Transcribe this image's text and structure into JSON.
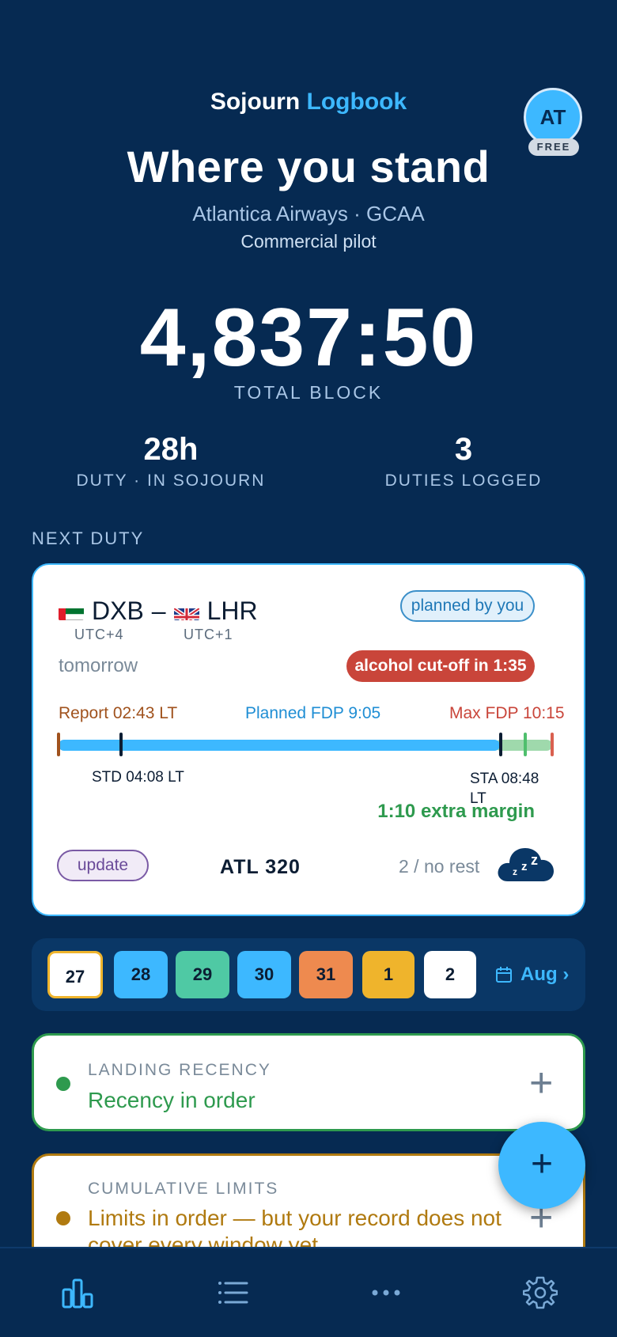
{
  "header": {
    "brand_part1": "Sojourn",
    "brand_part2": "Logbook",
    "title": "Where you stand",
    "airline_authority": "Atlantica Airways · GCAA",
    "role": "Commercial pilot",
    "avatar_initials": "AT",
    "plan_badge": "FREE"
  },
  "totals": {
    "total_block": "4,837:50",
    "total_block_label": "TOTAL BLOCK",
    "duty_value": "28h",
    "duty_label": "DUTY · IN SOJOURN",
    "duties_value": "3",
    "duties_label": "DUTIES LOGGED"
  },
  "next_duty": {
    "section_label": "NEXT DUTY",
    "origin": "DXB",
    "dash": "–",
    "destination": "LHR",
    "origin_utc": "UTC+4",
    "destination_utc": "UTC+1",
    "planned_badge": "planned by you",
    "when": "tomorrow",
    "alcohol_badge": "alcohol cut-off in 1:35",
    "report": "Report 02:43 LT",
    "planned_fdp": "Planned FDP 9:05",
    "max_fdp": "Max FDP 10:15",
    "std": "STD 04:08 LT",
    "sta": "STA 08:48 LT",
    "extra_margin": "1:10 extra margin",
    "update_button": "update",
    "aircraft": "ATL 320",
    "rest": "2 / no rest",
    "sleep_icon": "sleep-cloud-icon"
  },
  "date_strip": {
    "days": [
      {
        "label": "27",
        "color": "#ffffff",
        "selected": true
      },
      {
        "label": "28",
        "color": "#3db8ff"
      },
      {
        "label": "29",
        "color": "#4fc9a4"
      },
      {
        "label": "30",
        "color": "#3db8ff"
      },
      {
        "label": "31",
        "color": "#ee8a4f"
      },
      {
        "label": "1",
        "color": "#efb42c"
      },
      {
        "label": "2",
        "color": "#ffffff"
      }
    ],
    "month_link": "Aug ›"
  },
  "landing_recency": {
    "title": "LANDING RECENCY",
    "text": "Recency in order",
    "color": "#2e9a4e"
  },
  "cumulative_limits": {
    "title": "CUMULATIVE LIMITS",
    "text": "Limits in order — but your record does not cover every window yet",
    "color": "#b07a10"
  },
  "fab_label": "+",
  "nav": [
    "chart-icon",
    "list-icon",
    "more-icon",
    "settings-icon"
  ],
  "colors": {
    "background": "#062a52",
    "accent": "#3db8ff",
    "danger": "#c9453a",
    "success": "#2e9a4e"
  }
}
